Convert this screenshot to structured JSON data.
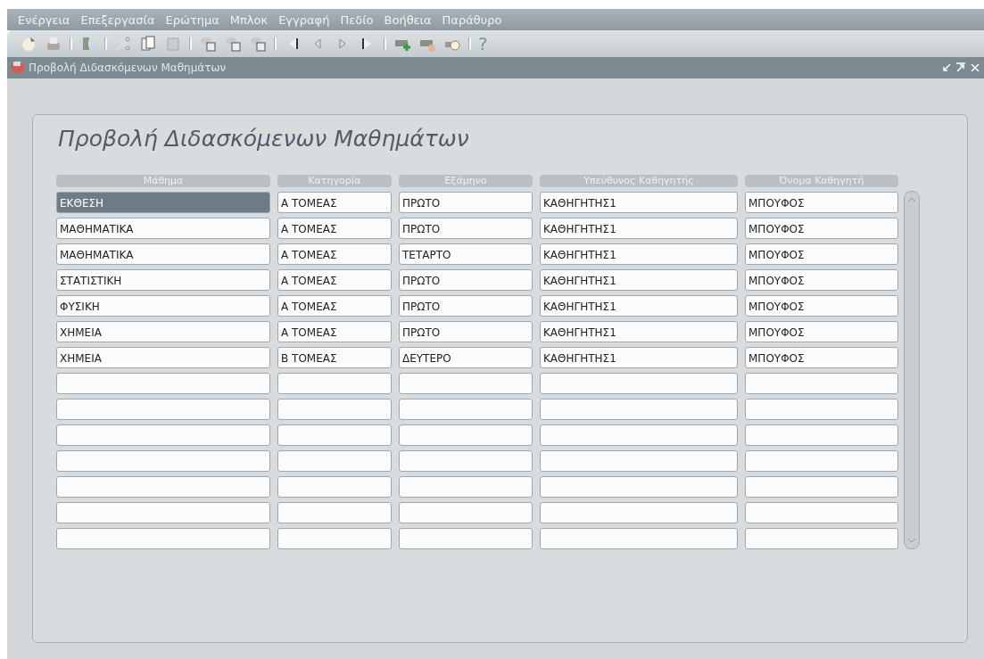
{
  "menu": [
    "Ενέργεια",
    "Επεξεργασία",
    "Ερώτημα",
    "Μπλοκ",
    "Εγγραφή",
    "Πεδίο",
    "Βοήθεια",
    "Παράθυρο"
  ],
  "toolbar": {
    "help": "?"
  },
  "window": {
    "title": "Προβολή Διδασκόμενων Μαθημάτων"
  },
  "form": {
    "heading": "Προβολή Διδασκόμενων Μαθημάτων",
    "columns": [
      "Μάθημα",
      "Κατηγορία",
      "Εξάμηνο",
      "Υπεύθυνος Καθηγητής",
      "Όνομα Καθηγητή"
    ],
    "rows": [
      {
        "selected": true,
        "cells": [
          "ΕΚΘΕΣΗ",
          "Α ΤΟΜΕΑΣ",
          "ΠΡΩΤΟ",
          "ΚΑΘΗΓΗΤΗΣ1",
          "ΜΠΟΥΦΟΣ"
        ]
      },
      {
        "selected": false,
        "cells": [
          "ΜΑΘΗΜΑΤΙΚΑ",
          "Α ΤΟΜΕΑΣ",
          "ΠΡΩΤΟ",
          "ΚΑΘΗΓΗΤΗΣ1",
          "ΜΠΟΥΦΟΣ"
        ]
      },
      {
        "selected": false,
        "cells": [
          "ΜΑΘΗΜΑΤΙΚΑ",
          "Α ΤΟΜΕΑΣ",
          "ΤΕΤΑΡΤΟ",
          "ΚΑΘΗΓΗΤΗΣ1",
          "ΜΠΟΥΦΟΣ"
        ]
      },
      {
        "selected": false,
        "cells": [
          "ΣΤΑΤΙΣΤΙΚΗ",
          "Α ΤΟΜΕΑΣ",
          "ΠΡΩΤΟ",
          "ΚΑΘΗΓΗΤΗΣ1",
          "ΜΠΟΥΦΟΣ"
        ]
      },
      {
        "selected": false,
        "cells": [
          "ΦΥΣΙΚΗ",
          "Α ΤΟΜΕΑΣ",
          "ΠΡΩΤΟ",
          "ΚΑΘΗΓΗΤΗΣ1",
          "ΜΠΟΥΦΟΣ"
        ]
      },
      {
        "selected": false,
        "cells": [
          "ΧΗΜΕΙΑ",
          "Α ΤΟΜΕΑΣ",
          "ΠΡΩΤΟ",
          "ΚΑΘΗΓΗΤΗΣ1",
          "ΜΠΟΥΦΟΣ"
        ]
      },
      {
        "selected": false,
        "cells": [
          "ΧΗΜΕΙΑ",
          "Β ΤΟΜΕΑΣ",
          "ΔΕΥΤΕΡΟ",
          "ΚΑΘΗΓΗΤΗΣ1",
          "ΜΠΟΥΦΟΣ"
        ]
      },
      {
        "selected": false
      },
      {
        "selected": false
      },
      {
        "selected": false
      },
      {
        "selected": false
      },
      {
        "selected": false
      },
      {
        "selected": false
      },
      {
        "selected": false
      }
    ]
  }
}
